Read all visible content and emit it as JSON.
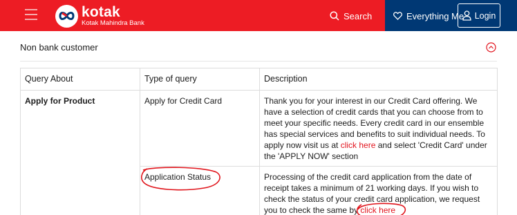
{
  "header": {
    "brand_name": "kotak",
    "brand_sub": "Kotak Mahindra Bank",
    "search_label": "Search",
    "everything_label": "Everything Me",
    "login_label": "Login",
    "colors": {
      "red": "#ed1c24",
      "navy": "#003874"
    }
  },
  "section": {
    "title": "Non bank customer"
  },
  "table": {
    "headers": [
      "Query About",
      "Type of query",
      "Description"
    ],
    "rows": [
      {
        "query_about": "Apply for Product",
        "type": "Apply for Credit Card",
        "desc_before": "Thank you for your interest in our Credit Card offering. We have a selection of credit cards that you can choose from to meet your specific needs. Every credit card in our ensemble has special services and benefits to suit individual needs. To apply now visit us at ",
        "link": "click here",
        "desc_after": " and select 'Credit Card' under the 'APPLY NOW' section"
      },
      {
        "query_about": "",
        "type": "Application Status",
        "desc_before": "Processing of the credit card application from the date of receipt takes a minimum of 21 working days. If you wish to check the status of your credit card application, we request you to check the same by ",
        "link": "click here",
        "desc_after": ""
      }
    ]
  }
}
